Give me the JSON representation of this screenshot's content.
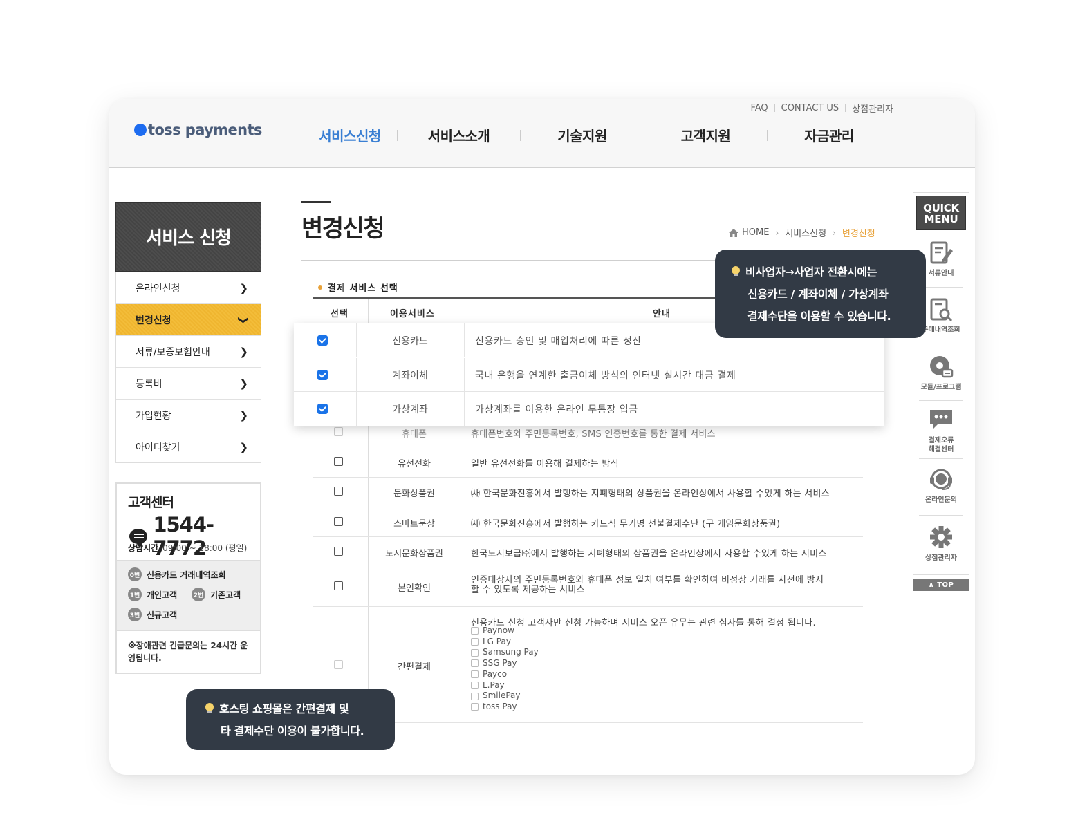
{
  "brand": {
    "logo_text": "toss payments",
    "accent": "#3a7fd3",
    "brand_blue": "#1d6cf0",
    "highlight_orange": "#f1b934"
  },
  "util_links": [
    "FAQ",
    "CONTACT US",
    "상점관리자"
  ],
  "gnb": [
    "서비스신청",
    "서비스소개",
    "기술지원",
    "고객지원",
    "자금관리"
  ],
  "lnb": {
    "title": "서비스 신청",
    "items": [
      "온라인신청",
      "변경신청",
      "서류/보증보험안내",
      "등록비",
      "가입현황",
      "아이디찾기"
    ]
  },
  "customer_center": {
    "title": "고객센터",
    "phone": "1544-7772",
    "hours_label": "상담시간",
    "hours": "09:00 ~ 18:00 (평일)",
    "options": [
      {
        "num": "0번",
        "label": "신용카드 거래내역조회"
      },
      {
        "num": "1번",
        "label": "개인고객"
      },
      {
        "num": "2번",
        "label": "기존고객"
      },
      {
        "num": "3번",
        "label": "신규고객"
      }
    ],
    "note": "※장애관련 긴급문의는 24시간 운영됩니다."
  },
  "page": {
    "title": "변경신청",
    "breadcrumb": [
      "HOME",
      "서비스신청",
      "변경신청"
    ],
    "section_title": "결제 서비스 선택"
  },
  "table": {
    "headers": [
      "선택",
      "이용서비스",
      "안내"
    ],
    "highlighted_rows": [
      {
        "service": "신용카드",
        "desc": "신용카드 승인 및 매입처리에 따른 정산",
        "checked": true
      },
      {
        "service": "계좌이체",
        "desc": "국내 은행을 연계한 출금이체 방식의 인터넷 실시간 대금 결제",
        "checked": true
      },
      {
        "service": "가상계좌",
        "desc": "가상계좌를 이용한 온라인 무통장 입금",
        "checked": true
      }
    ],
    "rows": [
      {
        "service": "휴대폰",
        "desc": "휴대폰번호와 주민등록번호, SMS 인증번호를 통한 결제 서비스"
      },
      {
        "service": "유선전화",
        "desc": "일반 유선전화를 이용해 결제하는 방식"
      },
      {
        "service": "문화상품권",
        "desc": "㈔ 한국문화진흥에서 발행하는 지폐형태의 상품권을 온라인상에서 사용할 수있게 하는 서비스"
      },
      {
        "service": "스마트문상",
        "desc": "㈔ 한국문화진흥에서 발행하는 카드식 무기명 선불결제수단 (구 게임문화상품권)"
      },
      {
        "service": "도서문화상품권",
        "desc": "한국도서보급㈜에서 발행하는 지폐형태의 상품권을 온라인상에서 사용할 수있게 하는 서비스"
      },
      {
        "service": "본인확인",
        "desc_line1": "인증대상자의 주민등록번호와 휴대폰 정보 일치 여부를 확인하여 비정상 거래를 사전에 방지",
        "desc_line2": "할 수 있도록 제공하는 서비스"
      },
      {
        "service": "간편결제",
        "desc": "신용카드 신청 고객사만 신청 가능하며 서비스 오픈 유무는 관련 심사를 통해 결정 됩니다.",
        "sub_options": [
          "Paynow",
          "LG Pay",
          "Samsung Pay",
          "SSG Pay",
          "Payco",
          "L.Pay",
          "SmilePay",
          "toss Pay"
        ]
      }
    ]
  },
  "tooltips": {
    "top_right": [
      "비사업자→사업자 전환시에는",
      "신용카드 / 계좌이체 / 가상계좌",
      "결제수단을 이용할 수 있습니다."
    ],
    "bottom_left": [
      "호스팅 쇼핑몰은 간편결제 및",
      "타 결제수단 이용이 불가합니다."
    ]
  },
  "quick_menu": {
    "title_line1": "QUICK",
    "title_line2": "MENU",
    "items": [
      {
        "icon": "document-edit-icon",
        "label": "서류안내"
      },
      {
        "icon": "search-document-icon",
        "label": "구매내역조회"
      },
      {
        "icon": "module-disc-icon",
        "label": "모듈/프로그램"
      },
      {
        "icon": "error-chat-icon",
        "label_line1": "결제오류",
        "label_line2": "해결센터"
      },
      {
        "icon": "headset-icon",
        "label": "온라인문의"
      },
      {
        "icon": "gear-icon",
        "label": "상점관리자"
      }
    ],
    "top_label": "TOP"
  }
}
